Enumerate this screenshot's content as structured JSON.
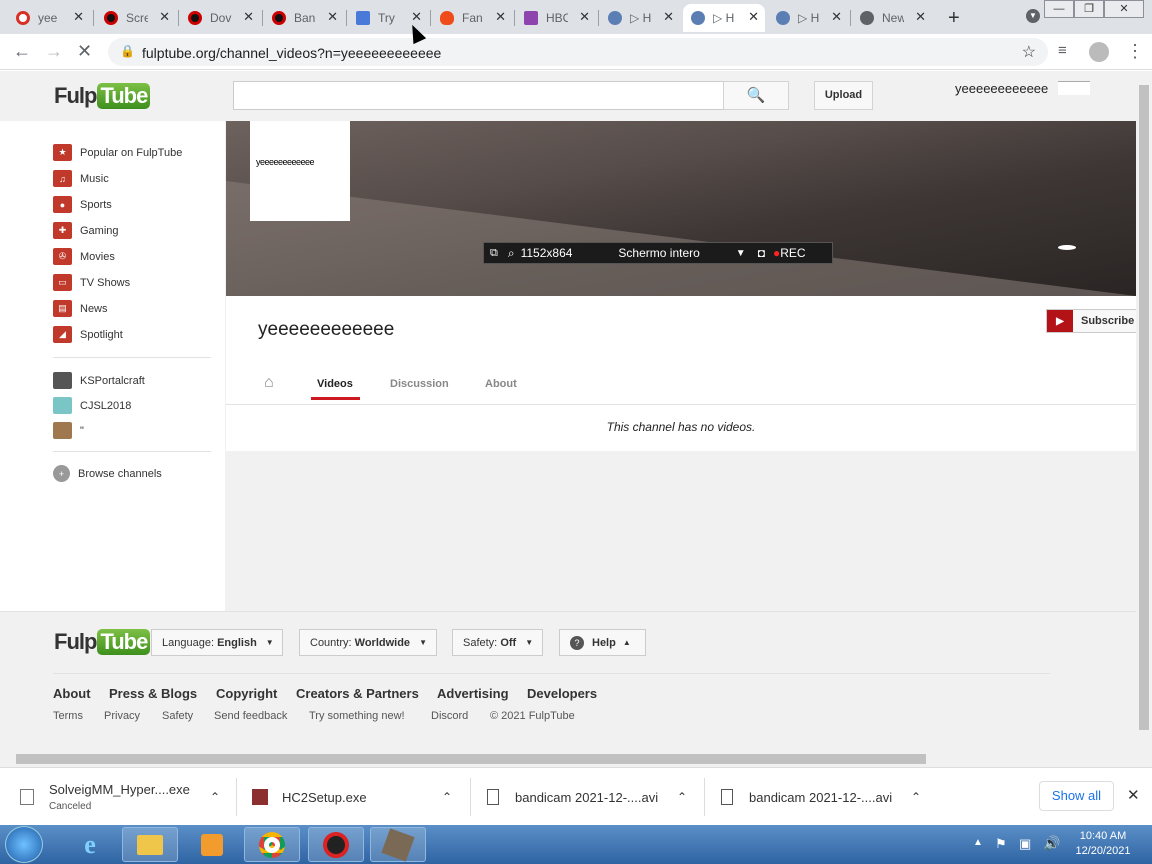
{
  "browser": {
    "tabs": [
      {
        "title": "yee",
        "color": "#d93025"
      },
      {
        "title": "Scre",
        "color": "#c00"
      },
      {
        "title": "Dov",
        "color": "#c00"
      },
      {
        "title": "Ban",
        "color": "#c00"
      },
      {
        "title": "Try",
        "color": "#4a7ad9"
      },
      {
        "title": "Fan",
        "color": "#f04b1a"
      },
      {
        "title": "HBO",
        "color": "#8e44ad"
      },
      {
        "title": "▷ H",
        "color": "#5b7fb5"
      },
      {
        "title": "▷ H",
        "color": "#5b7fb5"
      },
      {
        "title": "▷ H",
        "color": "#5b7fb5"
      },
      {
        "title": "New",
        "color": "#5f6368"
      }
    ],
    "url": "fulptube.org/channel_videos?n=yeeeeeeeeeeee"
  },
  "site": {
    "logo_a": "Fulp",
    "logo_b": "Tube",
    "upload": "Upload",
    "username": "yeeeeeeeeeeee",
    "guide": [
      "Popular on FulpTube",
      "Music",
      "Sports",
      "Gaming",
      "Movies",
      "TV Shows",
      "News",
      "Spotlight"
    ],
    "subs": [
      "KSPortalcraft",
      "CJSL2018",
      "\""
    ],
    "browse": "Browse channels"
  },
  "channel": {
    "thumb_text": "yeeeeeeeeeeee",
    "name": "yeeeeeeeeeeee",
    "subscribe": "Subscribe",
    "tabs": [
      "Videos",
      "Discussion",
      "About"
    ],
    "empty": "This channel has no videos."
  },
  "recorder": {
    "resolution": "1152x864",
    "mode": "Schermo intero",
    "rec": "REC"
  },
  "footer": {
    "language_label": "Language:",
    "language": "English",
    "country_label": "Country:",
    "country": "Worldwide",
    "safety_label": "Safety:",
    "safety": "Off",
    "help": "Help",
    "links": [
      "About",
      "Press & Blogs",
      "Copyright",
      "Creators & Partners",
      "Advertising",
      "Developers"
    ],
    "sub": [
      "Terms",
      "Privacy",
      "Safety",
      "Send feedback",
      "Try something new!",
      "Discord",
      "© 2021 FulpTube"
    ]
  },
  "downloads": {
    "items": [
      {
        "name": "SolveigMM_Hyper....exe",
        "status": "Canceled"
      },
      {
        "name": "HC2Setup.exe"
      },
      {
        "name": "bandicam 2021-12-....avi"
      },
      {
        "name": "bandicam 2021-12-....avi"
      }
    ],
    "show_all": "Show all"
  },
  "taskbar": {
    "time": "10:40 AM",
    "date": "12/20/2021"
  }
}
